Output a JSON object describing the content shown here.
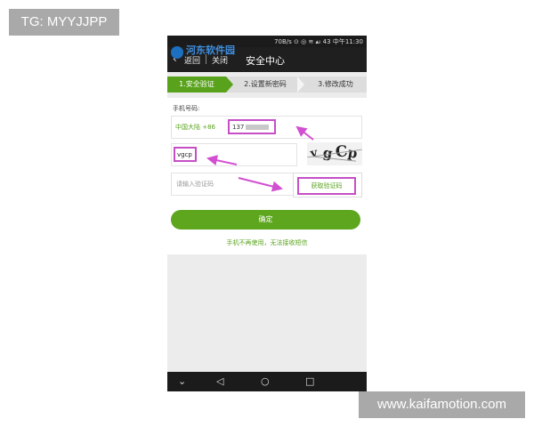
{
  "watermarks": {
    "top_left": "TG: MYYJJPP",
    "bottom_right": "www.kaifamotion.com"
  },
  "status_bar": {
    "text": "70B/s ⊙ ◎ ≋ ▴ᵢₗ 43 中午11:30"
  },
  "site_logo": {
    "text": "河东软件园"
  },
  "header": {
    "back_label": "返回",
    "close_label": "关闭",
    "title": "安全中心"
  },
  "steps": [
    {
      "label": "1.安全验证",
      "active": true
    },
    {
      "label": "2.设置新密码",
      "active": false
    },
    {
      "label": "3.修改成功",
      "active": false
    }
  ],
  "form": {
    "phone_label": "手机号码:",
    "region": "中国大陆 +86",
    "phone_prefix": "137",
    "captcha_value": "vgcp",
    "captcha_image_chars": [
      "v",
      "g",
      "C",
      "p"
    ],
    "sms_placeholder": "请输入验证码",
    "get_code_label": "获取验证码",
    "confirm_label": "确定",
    "no_phone_link": "手机不再使用，无法接收短信"
  },
  "colors": {
    "accent_green": "#5da61e",
    "highlight_magenta": "#c64fc6",
    "bar_dark": "#1b1b1b"
  },
  "nav_icons": [
    "chevron-down-icon",
    "back-triangle-icon",
    "home-circle-icon",
    "recents-square-icon"
  ]
}
